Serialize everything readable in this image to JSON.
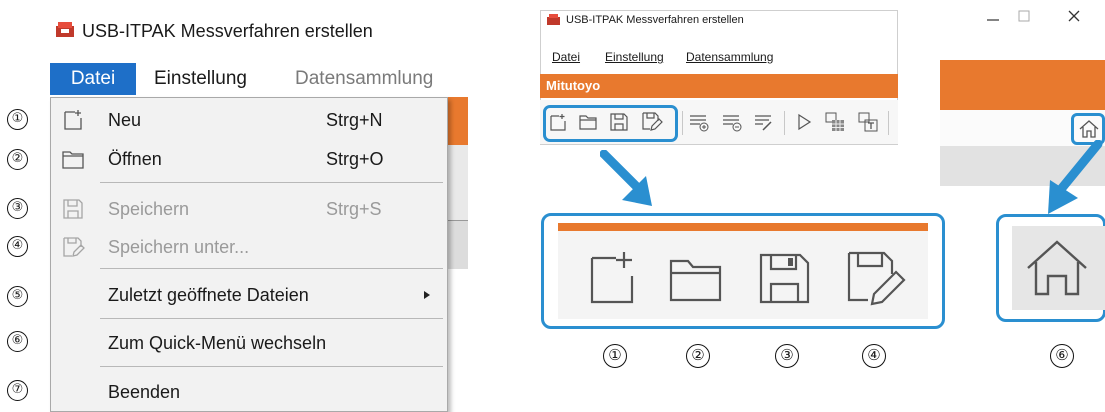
{
  "panel1": {
    "window_title": "USB-ITPAK Messverfahren erstellen",
    "menubar": [
      "Datei",
      "Einstellung",
      "Datensammlung"
    ],
    "menu_items": [
      {
        "num": "①",
        "label": "Neu",
        "shortcut": "Strg+N",
        "icon": "new-file-icon",
        "enabled": true
      },
      {
        "num": "②",
        "label": "Öffnen",
        "shortcut": "Strg+O",
        "icon": "folder-icon",
        "enabled": true
      },
      {
        "num": "③",
        "label": "Speichern",
        "shortcut": "Strg+S",
        "icon": "save-icon",
        "enabled": false
      },
      {
        "num": "④",
        "label": "Speichern unter...",
        "shortcut": "",
        "icon": "save-as-icon",
        "enabled": false
      },
      {
        "num": "⑤",
        "label": "Zuletzt geöffnete Dateien",
        "shortcut": "",
        "icon": "submenu-arrow-icon",
        "enabled": true
      },
      {
        "num": "⑥",
        "label": "Zum Quick-Menü wechseln",
        "shortcut": "",
        "icon": "",
        "enabled": true
      },
      {
        "num": "⑦",
        "label": "Beenden",
        "shortcut": "",
        "icon": "",
        "enabled": true
      }
    ]
  },
  "panel2": {
    "window_title": "USB-ITPAK Messverfahren erstellen",
    "menubar": [
      "Datei",
      "Einstellung",
      "Datensammlung"
    ],
    "brand": "Mitutoyo",
    "toolbar_icons": [
      "new-file-icon",
      "folder-icon",
      "save-icon",
      "save-as-icon",
      "add-row-icon",
      "remove-row-icon",
      "edit-list-icon",
      "play-icon",
      "table-icon",
      "export-icon"
    ],
    "zoom_labels": [
      "①",
      "②",
      "③",
      "④"
    ]
  },
  "panel3": {
    "window_controls": [
      "minimize-icon",
      "maximize-icon",
      "close-icon"
    ],
    "home_icon": "home-icon",
    "zoom_label": "⑥"
  },
  "colors": {
    "accent_orange": "#e8792e",
    "highlight_blue": "#2a8fd0",
    "menu_selected": "#1e6fc8"
  }
}
